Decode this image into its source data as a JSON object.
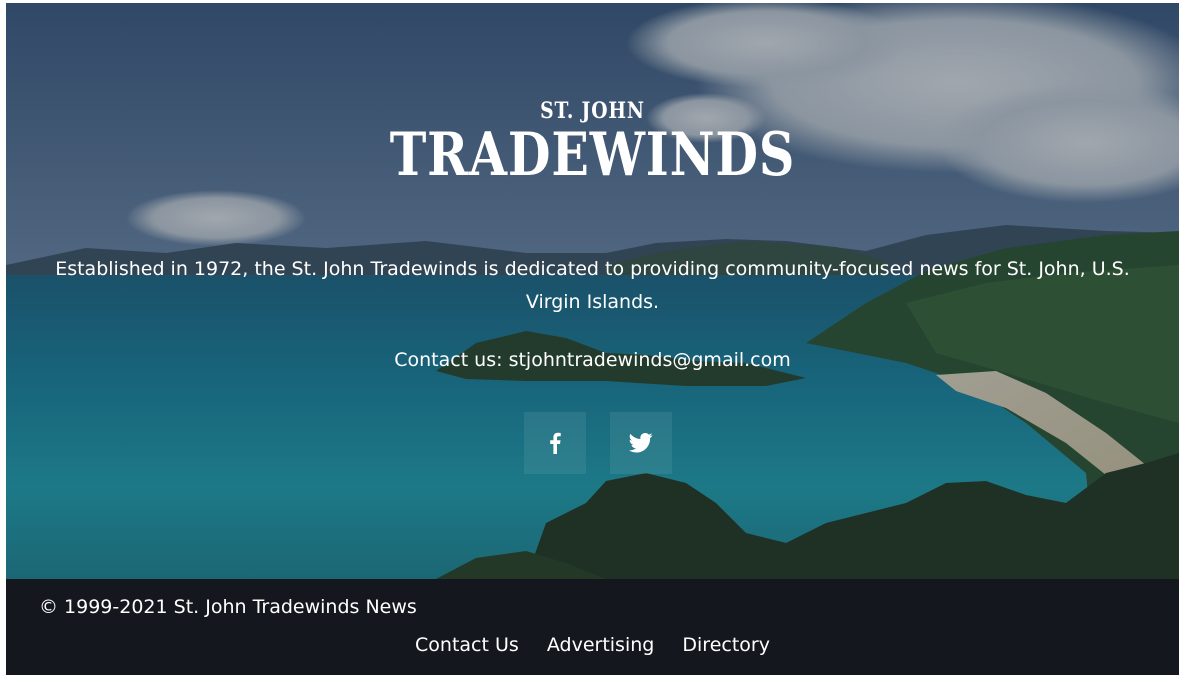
{
  "hero": {
    "logo_top": "ST. JOHN",
    "logo_main": "TRADEWINDS",
    "tagline": "Established in 1972, the St. John Tradewinds is dedicated to providing community-focused news for St. John, U.S. Virgin Islands.",
    "contact_prefix": "Contact us: ",
    "contact_email": "stjohntradewinds@gmail.com",
    "social": [
      {
        "name": "facebook",
        "icon": "facebook-icon"
      },
      {
        "name": "twitter",
        "icon": "twitter-icon"
      }
    ]
  },
  "footer": {
    "copyright": "© 1999-2021 St. John Tradewinds News",
    "links": [
      "Contact Us",
      "Advertising",
      "Directory"
    ]
  },
  "colors": {
    "footer_bg": "#14181e",
    "text": "#ffffff"
  }
}
